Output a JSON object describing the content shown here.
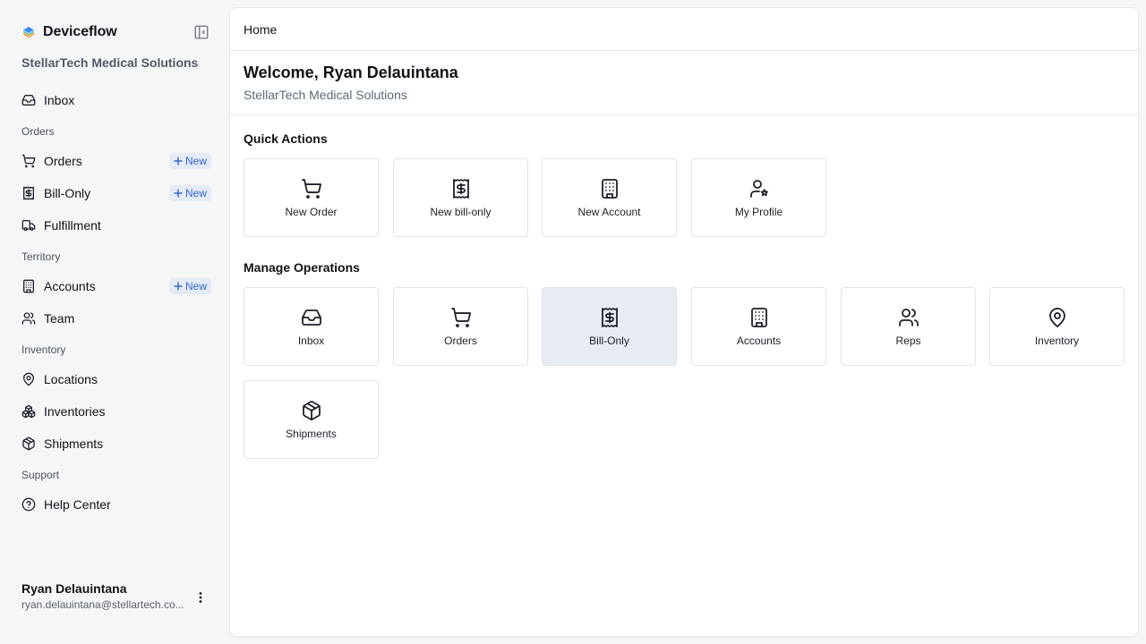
{
  "app": {
    "name": "Deviceflow",
    "org": "StellarTech Medical Solutions",
    "accent": "#3369c9"
  },
  "sidebar": {
    "new_label": "New",
    "inbox": {
      "label": "Inbox",
      "icon": "inbox-icon"
    },
    "sections": {
      "orders": "Orders",
      "territory": "Territory",
      "inventory": "Inventory",
      "support": "Support"
    },
    "items": {
      "orders": {
        "label": "Orders",
        "icon": "cart-icon"
      },
      "bill_only": {
        "label": "Bill-Only",
        "icon": "receipt-icon"
      },
      "fulfillment": {
        "label": "Fulfillment",
        "icon": "truck-icon"
      },
      "accounts": {
        "label": "Accounts",
        "icon": "building-icon"
      },
      "team": {
        "label": "Team",
        "icon": "users-icon"
      },
      "locations": {
        "label": "Locations",
        "icon": "map-pin-icon"
      },
      "inventories": {
        "label": "Inventories",
        "icon": "boxes-icon"
      },
      "shipments": {
        "label": "Shipments",
        "icon": "package-icon"
      },
      "help_center": {
        "label": "Help Center",
        "icon": "help-circle-icon"
      }
    },
    "user": {
      "name": "Ryan Delauintana",
      "email": "ryan.delauintana@stellartech.co..."
    }
  },
  "main": {
    "breadcrumb": "Home",
    "welcome": "Welcome, Ryan Delauintana",
    "org": "StellarTech Medical Solutions",
    "quick_actions": {
      "title": "Quick Actions",
      "tiles": [
        {
          "label": "New Order",
          "icon": "cart-icon"
        },
        {
          "label": "New bill-only",
          "icon": "receipt-icon"
        },
        {
          "label": "New Account",
          "icon": "building-icon"
        },
        {
          "label": "My Profile",
          "icon": "user-star-icon"
        }
      ]
    },
    "manage_operations": {
      "title": "Manage Operations",
      "tiles": [
        {
          "label": "Inbox",
          "icon": "inbox-icon"
        },
        {
          "label": "Orders",
          "icon": "cart-icon"
        },
        {
          "label": "Bill-Only",
          "icon": "receipt-icon",
          "active": true
        },
        {
          "label": "Accounts",
          "icon": "building-icon"
        },
        {
          "label": "Reps",
          "icon": "users-icon"
        },
        {
          "label": "Inventory",
          "icon": "map-pin-icon"
        },
        {
          "label": "Shipments",
          "icon": "package-icon"
        }
      ]
    }
  }
}
